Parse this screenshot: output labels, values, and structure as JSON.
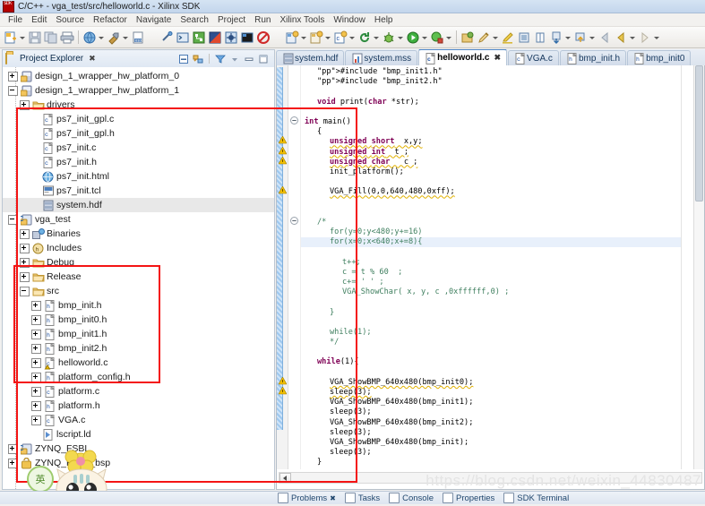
{
  "window": {
    "title": "C/C++ - vga_test/src/helloworld.c - Xilinx SDK",
    "app_icon": "sdk-icon"
  },
  "menubar": {
    "items": [
      "File",
      "Edit",
      "Source",
      "Refactor",
      "Navigate",
      "Search",
      "Project",
      "Run",
      "Xilinx Tools",
      "Window",
      "Help"
    ]
  },
  "toolbar": {
    "groups": [
      {
        "name": "new-group",
        "buttons": [
          {
            "name": "new-wizard",
            "label": "New",
            "dropdown": true
          },
          {
            "name": "save",
            "label": "Save",
            "dropdown": false
          },
          {
            "name": "save-all",
            "label": "Save All",
            "dropdown": false
          },
          {
            "name": "print",
            "label": "Print",
            "dropdown": false
          }
        ]
      },
      {
        "name": "build-group",
        "buttons": [
          {
            "name": "build-all",
            "label": "Build All",
            "dropdown": true
          },
          {
            "name": "build-project",
            "label": "Build Project",
            "dropdown": true
          },
          {
            "name": "program-fpga",
            "label": "Program FPGA",
            "dropdown": false
          }
        ]
      },
      {
        "name": "xilinx-group",
        "buttons": [
          {
            "name": "flash-tool",
            "label": "Program Flash",
            "dropdown": false
          },
          {
            "name": "xsct-console",
            "label": "XSCT Console",
            "dropdown": false
          },
          {
            "name": "repositories",
            "label": "Repositories",
            "dropdown": false
          },
          {
            "name": "launch-sdk",
            "label": "Launch Shell",
            "dropdown": false
          },
          {
            "name": "hw-debug",
            "label": "Hardware Debug",
            "dropdown": false
          },
          {
            "name": "terminal",
            "label": "Terminal",
            "dropdown": false
          },
          {
            "name": "bsp-settings",
            "label": "BSP Settings",
            "dropdown": false
          }
        ]
      },
      {
        "name": "newproj-group",
        "buttons": [
          {
            "name": "new-app-project",
            "label": "New Application Project",
            "dropdown": true
          },
          {
            "name": "new-bsp-project",
            "label": "New BSP Project",
            "dropdown": true
          },
          {
            "name": "new-c-project",
            "label": "New C Project",
            "dropdown": true
          },
          {
            "name": "refresh",
            "label": "Refresh",
            "dropdown": true
          },
          {
            "name": "debug",
            "label": "Debug",
            "dropdown": true
          },
          {
            "name": "run",
            "label": "Run",
            "dropdown": true
          },
          {
            "name": "profile",
            "label": "Profile",
            "dropdown": true
          }
        ]
      },
      {
        "name": "edit-group",
        "buttons": [
          {
            "name": "open-perspective",
            "label": "Open Perspective",
            "dropdown": false
          },
          {
            "name": "pencil-edit",
            "label": "Edit",
            "dropdown": true
          },
          {
            "name": "highlight",
            "label": "Toggle Mark Occurrences",
            "dropdown": false
          },
          {
            "name": "show-whitespace",
            "label": "Show Whitespace",
            "dropdown": false
          },
          {
            "name": "block-selection",
            "label": "Block Selection",
            "dropdown": false
          },
          {
            "name": "next-annotation",
            "label": "Next Annotation",
            "dropdown": true
          },
          {
            "name": "prev-annotation",
            "label": "Previous Annotation",
            "dropdown": true
          },
          {
            "name": "back",
            "label": "Back",
            "dropdown": false
          },
          {
            "name": "forward-prev",
            "label": "Previous Edit Location",
            "dropdown": true
          },
          {
            "name": "forward",
            "label": "Forward",
            "dropdown": true
          }
        ]
      }
    ]
  },
  "project_explorer": {
    "title": "Project Explorer",
    "close_label": "✖",
    "view_buttons": [
      {
        "name": "collapse-all-button",
        "label": "Collapse All"
      },
      {
        "name": "link-with-editor-button",
        "label": "Link with Editor"
      },
      {
        "name": "view-filter-button",
        "label": "Filters"
      },
      {
        "name": "view-menu-button",
        "label": "View Menu"
      },
      {
        "name": "minimize-button",
        "label": "Minimize"
      },
      {
        "name": "maximize-button",
        "label": "Maximize"
      }
    ],
    "tree": [
      {
        "label": "design_1_wrapper_hw_platform_0",
        "indent": 0,
        "expander": "plus",
        "icon": "project-icon"
      },
      {
        "label": "design_1_wrapper_hw_platform_1",
        "indent": 0,
        "expander": "minus",
        "icon": "project-icon"
      },
      {
        "label": "drivers",
        "indent": 1,
        "expander": "plus",
        "icon": "folder-icon"
      },
      {
        "label": "ps7_init_gpl.c",
        "indent": 2,
        "expander": "none",
        "icon": "c-file-icon"
      },
      {
        "label": "ps7_init_gpl.h",
        "indent": 2,
        "expander": "none",
        "icon": "c-file-icon"
      },
      {
        "label": "ps7_init.c",
        "indent": 2,
        "expander": "none",
        "icon": "c-file-icon"
      },
      {
        "label": "ps7_init.h",
        "indent": 2,
        "expander": "none",
        "icon": "c-file-icon"
      },
      {
        "label": "ps7_init.html",
        "indent": 2,
        "expander": "none",
        "icon": "html-file-icon"
      },
      {
        "label": "ps7_init.tcl",
        "indent": 2,
        "expander": "none",
        "icon": "tcl-file-icon"
      },
      {
        "label": "system.hdf",
        "indent": 2,
        "expander": "none",
        "icon": "hdf-file-icon",
        "selected": true
      },
      {
        "label": "vga_test",
        "indent": 0,
        "expander": "minus",
        "icon": "cproject-icon"
      },
      {
        "label": "Binaries",
        "indent": 1,
        "expander": "plus",
        "icon": "binaries-icon"
      },
      {
        "label": "Includes",
        "indent": 1,
        "expander": "plus",
        "icon": "includes-icon"
      },
      {
        "label": "Debug",
        "indent": 1,
        "expander": "plus",
        "icon": "folder-icon"
      },
      {
        "label": "Release",
        "indent": 1,
        "expander": "plus",
        "icon": "folder-icon"
      },
      {
        "label": "src",
        "indent": 1,
        "expander": "minus",
        "icon": "folder-icon"
      },
      {
        "label": "bmp_init.h",
        "indent": 2,
        "expander": "plus",
        "icon": "h-file-icon"
      },
      {
        "label": "bmp_init0.h",
        "indent": 2,
        "expander": "plus",
        "icon": "h-file-icon"
      },
      {
        "label": "bmp_init1.h",
        "indent": 2,
        "expander": "plus",
        "icon": "h-file-icon"
      },
      {
        "label": "bmp_init2.h",
        "indent": 2,
        "expander": "plus",
        "icon": "h-file-icon"
      },
      {
        "label": "helloworld.c",
        "indent": 2,
        "expander": "plus",
        "icon": "c-file-warning-icon"
      },
      {
        "label": "platform_config.h",
        "indent": 2,
        "expander": "plus",
        "icon": "h-file-icon"
      },
      {
        "label": "platform.c",
        "indent": 2,
        "expander": "plus",
        "icon": "c-file-icon"
      },
      {
        "label": "platform.h",
        "indent": 2,
        "expander": "plus",
        "icon": "h-file-icon"
      },
      {
        "label": "VGA.c",
        "indent": 2,
        "expander": "plus",
        "icon": "c-file-icon"
      },
      {
        "label": "lscript.ld",
        "indent": 2,
        "expander": "none",
        "icon": "ld-file-icon"
      },
      {
        "label": "ZYNQ_FSBL",
        "indent": 0,
        "expander": "plus",
        "icon": "cproject-icon"
      },
      {
        "label": "ZYNQ_FSBL_bsp",
        "indent": 0,
        "expander": "plus",
        "icon": "bsp-icon"
      }
    ]
  },
  "editor": {
    "tabs": [
      {
        "label": "system.hdf",
        "icon": "hdf-file-icon",
        "active": false,
        "closeable": false
      },
      {
        "label": "system.mss",
        "icon": "mss-file-icon",
        "active": false,
        "closeable": false
      },
      {
        "label": "helloworld.c",
        "icon": "c-file-icon",
        "active": true,
        "closeable": true,
        "close_label": "✖"
      },
      {
        "label": "VGA.c",
        "icon": "c-file-icon",
        "active": false,
        "closeable": false
      },
      {
        "label": "bmp_init.h",
        "icon": "h-file-icon",
        "active": false,
        "closeable": false
      },
      {
        "label": "bmp_init0",
        "icon": "h-file-icon",
        "active": false,
        "closeable": false
      }
    ],
    "lines": [
      {
        "indent": 1,
        "marker": "",
        "text": "#include \"bmp_init1.h\"",
        "type": "pp"
      },
      {
        "indent": 1,
        "marker": "",
        "text": "#include \"bmp_init2.h\"",
        "type": "pp"
      },
      {
        "indent": 1,
        "marker": "",
        "text": "",
        "type": "blank"
      },
      {
        "indent": 1,
        "marker": "",
        "text": "void print(char *str);",
        "type": "code"
      },
      {
        "indent": 1,
        "marker": "",
        "text": "",
        "type": "blank"
      },
      {
        "indent": 0,
        "marker": "fold",
        "text": "int main()",
        "type": "code"
      },
      {
        "indent": 1,
        "marker": "",
        "text": "{",
        "type": "code"
      },
      {
        "indent": 2,
        "marker": "warn",
        "text": "unsigned short  x,y;",
        "type": "warn"
      },
      {
        "indent": 2,
        "marker": "warn",
        "text": "unsigned int  t ;",
        "type": "warn"
      },
      {
        "indent": 2,
        "marker": "warn",
        "text": "unsigned char   c ;",
        "type": "warn"
      },
      {
        "indent": 2,
        "marker": "",
        "text": "init_platform();",
        "type": "code"
      },
      {
        "indent": 1,
        "marker": "",
        "text": "",
        "type": "blank"
      },
      {
        "indent": 2,
        "marker": "warn",
        "text": "VGA_Fill(0,0,640,480,0xff);",
        "type": "warn"
      },
      {
        "indent": 1,
        "marker": "",
        "text": "",
        "type": "blank"
      },
      {
        "indent": 1,
        "marker": "",
        "text": "",
        "type": "blank"
      },
      {
        "indent": 1,
        "marker": "fold",
        "text": "/*",
        "type": "comment"
      },
      {
        "indent": 2,
        "marker": "",
        "text": "for(y=0;y<480;y+=16)",
        "type": "comment"
      },
      {
        "indent": 2,
        "marker": "",
        "text": "for(x=0;x<640;x+=8){",
        "type": "comment",
        "highlight": true
      },
      {
        "indent": 1,
        "marker": "",
        "text": "",
        "type": "blank"
      },
      {
        "indent": 3,
        "marker": "",
        "text": "t++;",
        "type": "comment"
      },
      {
        "indent": 3,
        "marker": "",
        "text": "c = t % 60  ;",
        "type": "comment"
      },
      {
        "indent": 3,
        "marker": "",
        "text": "c+= ' ' ;",
        "type": "comment"
      },
      {
        "indent": 3,
        "marker": "",
        "text": "VGA_ShowChar( x, y, c ,0xffffff,0) ;",
        "type": "comment"
      },
      {
        "indent": 1,
        "marker": "",
        "text": "",
        "type": "blank"
      },
      {
        "indent": 2,
        "marker": "",
        "text": "}",
        "type": "comment"
      },
      {
        "indent": 1,
        "marker": "",
        "text": "",
        "type": "blank"
      },
      {
        "indent": 2,
        "marker": "",
        "text": "while(1);",
        "type": "comment"
      },
      {
        "indent": 2,
        "marker": "",
        "text": "*/",
        "type": "comment"
      },
      {
        "indent": 1,
        "marker": "",
        "text": "",
        "type": "blank"
      },
      {
        "indent": 1,
        "marker": "",
        "text": "while(1){",
        "type": "code"
      },
      {
        "indent": 1,
        "marker": "",
        "text": "",
        "type": "blank"
      },
      {
        "indent": 2,
        "marker": "warn",
        "text": "VGA_ShowBMP_640x480(bmp_init0);",
        "type": "warn"
      },
      {
        "indent": 2,
        "marker": "warn",
        "text": "sleep(3);",
        "type": "warn"
      },
      {
        "indent": 2,
        "marker": "",
        "text": "VGA_ShowBMP_640x480(bmp_init1);",
        "type": "code"
      },
      {
        "indent": 2,
        "marker": "",
        "text": "sleep(3);",
        "type": "code"
      },
      {
        "indent": 2,
        "marker": "",
        "text": "VGA_ShowBMP_640x480(bmp_init2);",
        "type": "code"
      },
      {
        "indent": 2,
        "marker": "",
        "text": "sleep(3);",
        "type": "code"
      },
      {
        "indent": 2,
        "marker": "",
        "text": "VGA_ShowBMP_640x480(bmp_init);",
        "type": "code"
      },
      {
        "indent": 2,
        "marker": "",
        "text": "sleep(3);",
        "type": "code"
      },
      {
        "indent": 1,
        "marker": "",
        "text": "}",
        "type": "code"
      },
      {
        "indent": 1,
        "marker": "",
        "text": "",
        "type": "blank"
      },
      {
        "indent": 1,
        "marker": "",
        "text": "}",
        "type": "code"
      }
    ],
    "hscroll_left_label": "◂"
  },
  "bottom_tabs": [
    {
      "label": "Problems",
      "icon": "problems-icon",
      "active": true,
      "close_label": "✖"
    },
    {
      "label": "Tasks",
      "icon": "tasks-icon",
      "active": false
    },
    {
      "label": "Console",
      "icon": "console-icon",
      "active": false
    },
    {
      "label": "Properties",
      "icon": "properties-icon",
      "active": false
    },
    {
      "label": "SDK Terminal",
      "icon": "terminal-icon",
      "active": false
    }
  ],
  "watermark": "https://blog.csdn.net/weixin_44830487",
  "mascot": {
    "badge_text": "英"
  },
  "annotations": {
    "src_box_name": "src-files-highlight-box",
    "code_box_name": "main-function-highlight-box",
    "color": "#f41414"
  },
  "colors": {
    "accent": "#4f86c6",
    "highlight_red": "#f41414",
    "keyword": "#7f0055",
    "string": "#2a00ff",
    "comment": "#3f7f5f"
  }
}
